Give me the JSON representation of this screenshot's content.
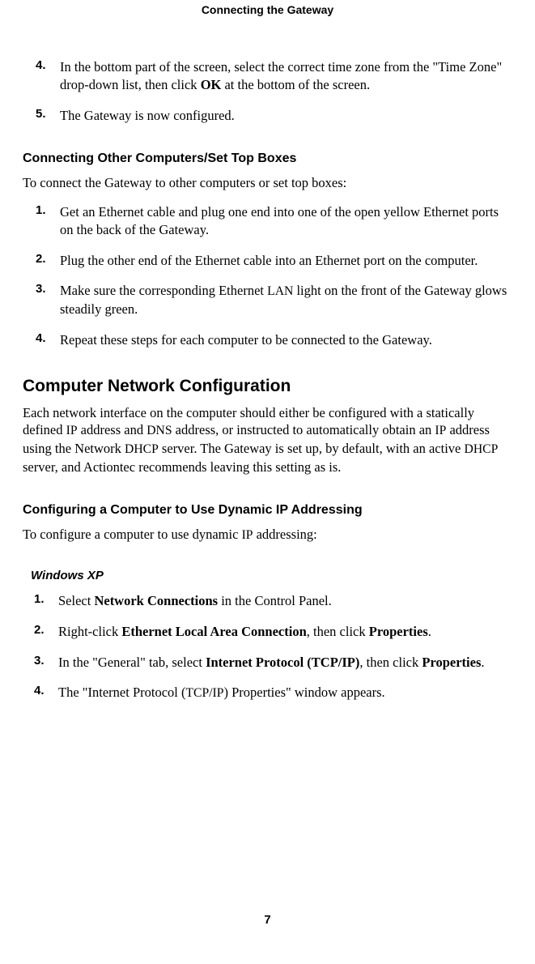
{
  "header": "Connecting the Gateway",
  "page_number": "7",
  "top_steps": [
    {
      "num": "4.",
      "parts": [
        {
          "t": "In the bottom part of the screen, select the correct time zone from the \"Time Zone\" drop-down list, then click "
        },
        {
          "t": "OK",
          "bold": true
        },
        {
          "t": " at the bottom of the screen."
        }
      ]
    },
    {
      "num": "5.",
      "parts": [
        {
          "t": "The Gateway is now configured."
        }
      ]
    }
  ],
  "section1": {
    "heading": "Connecting Other Computers/Set Top Boxes",
    "intro": "To connect the Gateway to other computers or set top boxes:"
  },
  "section1_steps": [
    {
      "num": "1.",
      "parts": [
        {
          "t": "Get an Ethernet cable and plug one end into one of the open yellow Ethernet ports on the back of the Gateway."
        }
      ]
    },
    {
      "num": "2.",
      "parts": [
        {
          "t": "Plug the other end of the Ethernet cable into an Ethernet port on the computer."
        }
      ]
    },
    {
      "num": "3.",
      "parts": [
        {
          "t": "Make sure the corresponding Ethernet "
        },
        {
          "t": "LAN",
          "sc": true
        },
        {
          "t": " light on the front of the Gateway glows steadily green."
        }
      ]
    },
    {
      "num": "4.",
      "parts": [
        {
          "t": "Repeat these steps for each computer to be connected to the Gateway."
        }
      ]
    }
  ],
  "main_heading": "Computer Network Configuration",
  "main_para_parts": [
    {
      "t": "Each network interface on the computer should either be configured with a stati­cally defined "
    },
    {
      "t": "IP",
      "sc": true
    },
    {
      "t": " address and "
    },
    {
      "t": "DNS",
      "sc": true
    },
    {
      "t": " address, or instructed to automatically obtain an "
    },
    {
      "t": "IP",
      "sc": true
    },
    {
      "t": " address using the Network "
    },
    {
      "t": "DHCP",
      "sc": true
    },
    {
      "t": " server. The Gateway is set up, by default, with an active "
    },
    {
      "t": "DHCP",
      "sc": true
    },
    {
      "t": " server, and Actiontec recommends leaving this setting as is."
    }
  ],
  "section2": {
    "heading": "Configuring a Computer to Use Dynamic IP Addressing"
  },
  "section2_intro_parts": [
    {
      "t": "To configure a computer to use dynamic "
    },
    {
      "t": "IP",
      "sc": true
    },
    {
      "t": " addressing:"
    }
  ],
  "winxp_heading": "Windows XP",
  "winxp_steps": [
    {
      "num": "1.",
      "parts": [
        {
          "t": "Select "
        },
        {
          "t": "Network Connections",
          "bold": true
        },
        {
          "t": " in the Control Panel."
        }
      ]
    },
    {
      "num": "2.",
      "parts": [
        {
          "t": "Right-click "
        },
        {
          "t": "Ethernet Local Area Connection",
          "bold": true
        },
        {
          "t": ", then click "
        },
        {
          "t": "Properties",
          "bold": true
        },
        {
          "t": "."
        }
      ]
    },
    {
      "num": "3.",
      "parts": [
        {
          "t": "In the \"General\" tab, select "
        },
        {
          "t": "Internet Protocol (TCP/IP)",
          "bold": true
        },
        {
          "t": ", then click "
        },
        {
          "t": "Properties",
          "bold": true
        },
        {
          "t": "."
        }
      ]
    },
    {
      "num": "4.",
      "parts": [
        {
          "t": "The \"Internet Protocol ("
        },
        {
          "t": "TCP/IP",
          "sc": true
        },
        {
          "t": ") Properties\" window appears."
        }
      ]
    }
  ]
}
